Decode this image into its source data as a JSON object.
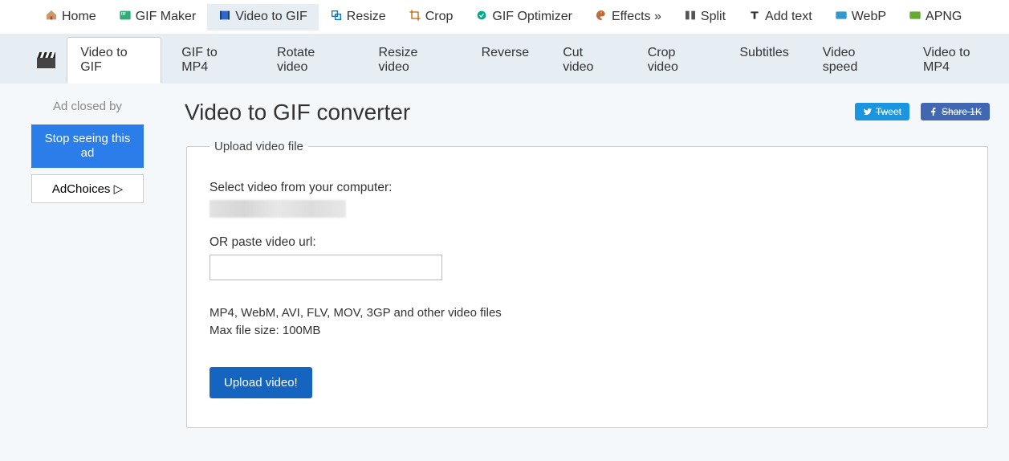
{
  "topnav": [
    {
      "label": "Home",
      "icon": "home"
    },
    {
      "label": "GIF Maker",
      "icon": "gif"
    },
    {
      "label": "Video to GIF",
      "icon": "film",
      "active": true
    },
    {
      "label": "Resize",
      "icon": "resize"
    },
    {
      "label": "Crop",
      "icon": "crop"
    },
    {
      "label": "GIF Optimizer",
      "icon": "optimize"
    },
    {
      "label": "Effects »",
      "icon": "palette"
    },
    {
      "label": "Split",
      "icon": "split"
    },
    {
      "label": "Add text",
      "icon": "text"
    },
    {
      "label": "WebP",
      "icon": "webp"
    },
    {
      "label": "APNG",
      "icon": "apng"
    }
  ],
  "subnav": [
    {
      "label": "Video to GIF",
      "active": true
    },
    {
      "label": "GIF to MP4"
    },
    {
      "label": "Rotate video"
    },
    {
      "label": "Resize video"
    },
    {
      "label": "Reverse"
    },
    {
      "label": "Cut video"
    },
    {
      "label": "Crop video"
    },
    {
      "label": "Subtitles"
    },
    {
      "label": "Video speed"
    },
    {
      "label": "Video to MP4"
    }
  ],
  "sidebar": {
    "closed_label": "Ad closed by",
    "stop_label": "Stop seeing this ad",
    "adchoices_label": "AdChoices ▷"
  },
  "share": {
    "tweet": "Tweet",
    "fb": "Share 1K"
  },
  "page_title": "Video to GIF converter",
  "form": {
    "legend": "Upload video file",
    "select_label": "Select video from your computer:",
    "or_label": "OR paste video url:",
    "hint_line1": "MP4, WebM, AVI, FLV, MOV, 3GP and other video files",
    "hint_line2": "Max file size: 100MB",
    "submit_label": "Upload video!"
  }
}
